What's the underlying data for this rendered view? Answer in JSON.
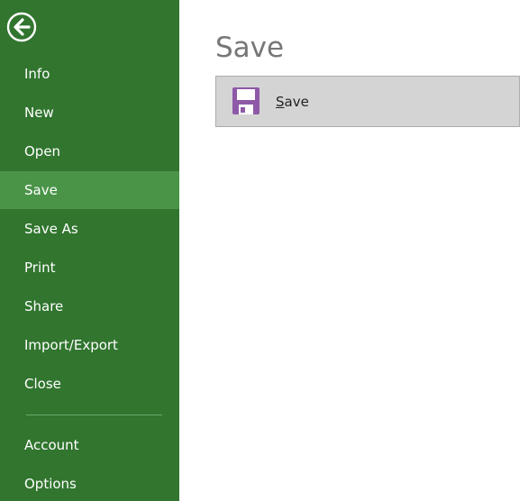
{
  "sidebar": {
    "back_icon": "back-arrow-icon",
    "items": [
      {
        "label": "Info"
      },
      {
        "label": "New"
      },
      {
        "label": "Open"
      },
      {
        "label": "Save",
        "selected": true
      },
      {
        "label": "Save As"
      },
      {
        "label": "Print"
      },
      {
        "label": "Share"
      },
      {
        "label": "Import/Export"
      },
      {
        "label": "Close"
      },
      {
        "label": "Account"
      },
      {
        "label": "Options"
      }
    ]
  },
  "main": {
    "title": "Save",
    "save_option": {
      "icon": "floppy-disk-icon",
      "mnemonic": "S",
      "label_rest": "ave"
    }
  },
  "colors": {
    "sidebar_bg": "#31752f",
    "sidebar_selected_bg": "#4a9448",
    "accent_icon": "#8e59a7",
    "option_bg": "#d4d4d4"
  }
}
